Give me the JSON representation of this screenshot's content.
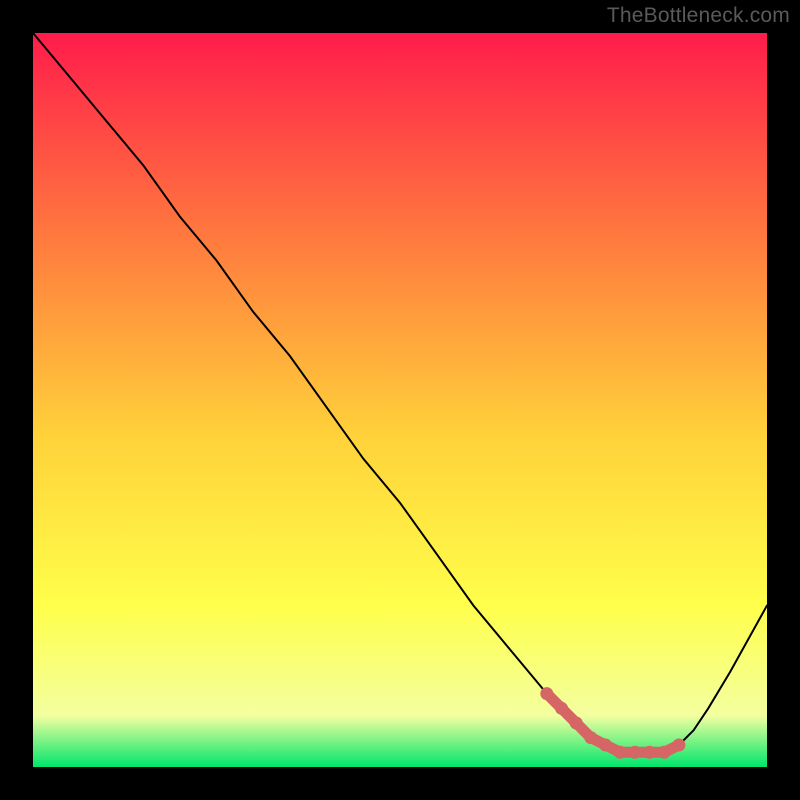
{
  "watermark": "TheBottleneck.com",
  "colors": {
    "background": "#000000",
    "gradient_top": "#ff1c4b",
    "gradient_mid_upper": "#ff7a3e",
    "gradient_mid": "#ffd23a",
    "gradient_mid_lower": "#ffff4a",
    "gradient_lower": "#f3ffa0",
    "gradient_bottom": "#00e66b",
    "curve": "#000000",
    "marker": "#d66565"
  },
  "chart_data": {
    "type": "line",
    "title": "",
    "xlabel": "",
    "ylabel": "",
    "xlim": [
      0,
      100
    ],
    "ylim": [
      0,
      100
    ],
    "series": [
      {
        "name": "bottleneck-curve",
        "x": [
          0,
          5,
          10,
          15,
          20,
          25,
          30,
          35,
          40,
          45,
          50,
          55,
          60,
          65,
          70,
          72,
          74,
          76,
          78,
          80,
          82,
          84,
          86,
          88,
          90,
          92,
          95,
          100
        ],
        "y": [
          100,
          94,
          88,
          82,
          75,
          69,
          62,
          56,
          49,
          42,
          36,
          29,
          22,
          16,
          10,
          8,
          6,
          4,
          3,
          2,
          2,
          2,
          2,
          3,
          5,
          8,
          13,
          22
        ]
      }
    ],
    "optimal_markers": {
      "name": "optimal-range",
      "x": [
        70,
        72,
        74,
        76,
        78,
        80,
        82,
        84,
        86,
        88
      ],
      "y": [
        10,
        8,
        6,
        4,
        3,
        2,
        2,
        2,
        2,
        3
      ]
    }
  }
}
